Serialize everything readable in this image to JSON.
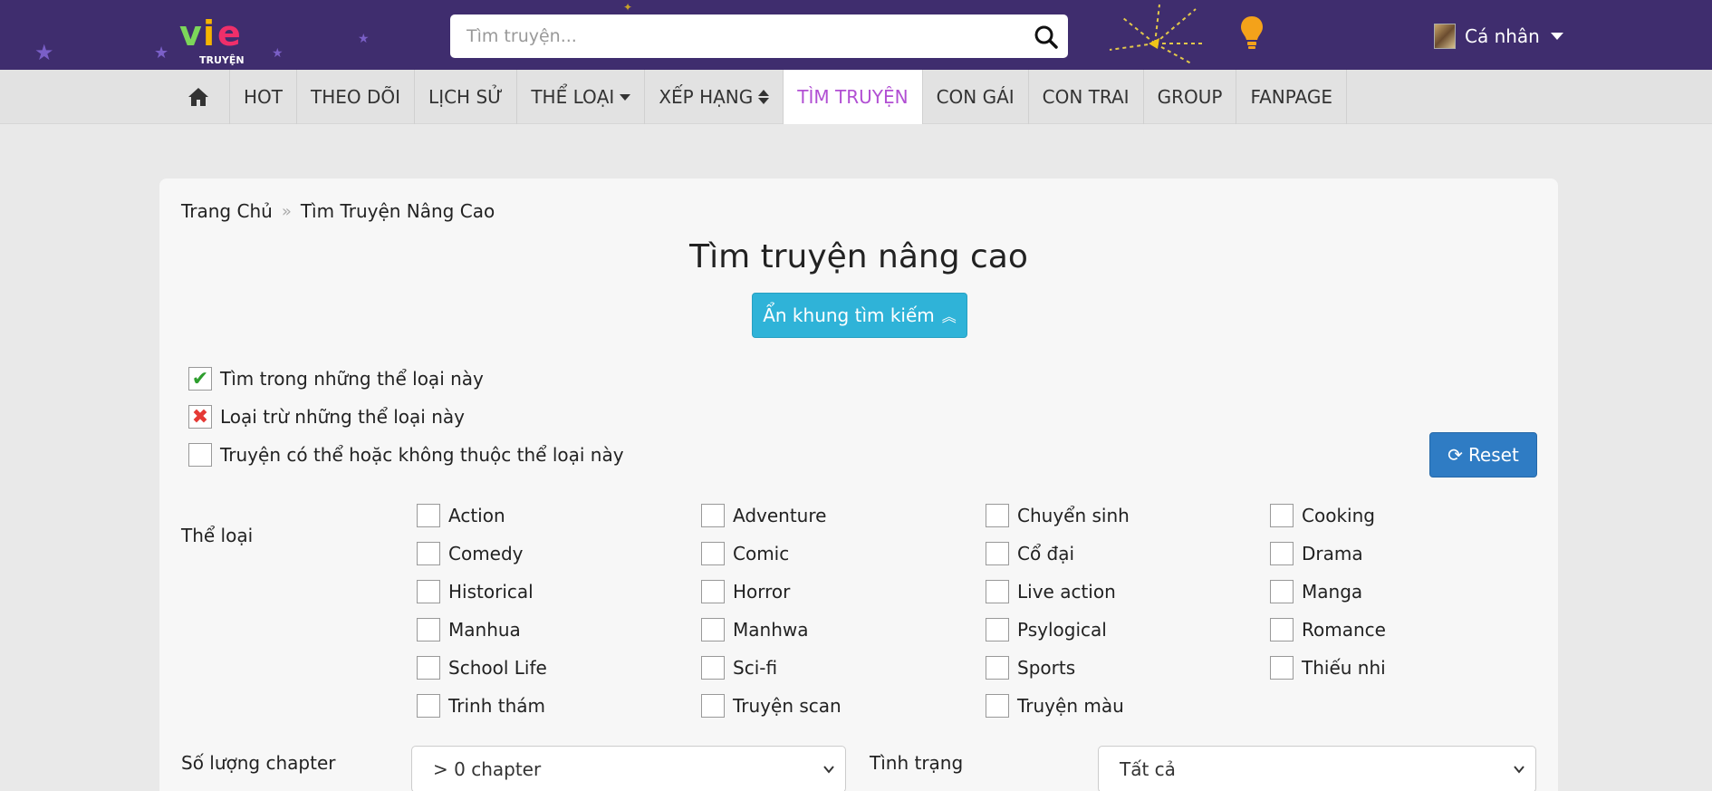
{
  "header": {
    "logo_text": "TRUYỆN",
    "search": {
      "placeholder": "Tìm truyện...",
      "value": ""
    },
    "user_label": "Cá nhân"
  },
  "nav": {
    "items": [
      {
        "label": "HOT"
      },
      {
        "label": "THEO DÕI"
      },
      {
        "label": "LỊCH SỬ"
      },
      {
        "label": "THỂ LOẠI"
      },
      {
        "label": "XẾP HẠNG"
      },
      {
        "label": "TÌM TRUYỆN",
        "active": true
      },
      {
        "label": "CON GÁI"
      },
      {
        "label": "CON TRAI"
      },
      {
        "label": "GROUP"
      },
      {
        "label": "FANPAGE"
      }
    ]
  },
  "breadcrumb": {
    "home": "Trang Chủ",
    "separator": "»",
    "current": "Tìm Truyện Nâng Cao"
  },
  "main": {
    "title": "Tìm truyện nâng cao",
    "toggle_label": "Ẩn khung tìm kiếm",
    "legend": {
      "include": "Tìm trong những thể loại này",
      "exclude": "Loại trừ những thể loại này",
      "neutral": "Truyện có thể hoặc không thuộc thể loại này"
    },
    "reset_label": "Reset",
    "genre_label": "Thể loại",
    "genres": [
      "Action",
      "Adventure",
      "Chuyển sinh",
      "Cooking",
      "Comedy",
      "Comic",
      "Cổ đại",
      "Drama",
      "Historical",
      "Horror",
      "Live action",
      "Manga",
      "Manhua",
      "Manhwa",
      "Psylogical",
      "Romance",
      "School Life",
      "Sci-fi",
      "Sports",
      "Thiếu nhi",
      "Trinh thám",
      "Truyện scan",
      "Truyện màu"
    ],
    "chapter_label": "Số lượng chapter",
    "chapter_value": "> 0 chapter",
    "status_label": "Tình trạng",
    "status_value": "Tất cả"
  },
  "colors": {
    "header_bg": "#3f2d6e",
    "nav_active": "#b14fd3",
    "toggle_button": "#2fb3d8",
    "reset_button": "#2f7cc4"
  }
}
